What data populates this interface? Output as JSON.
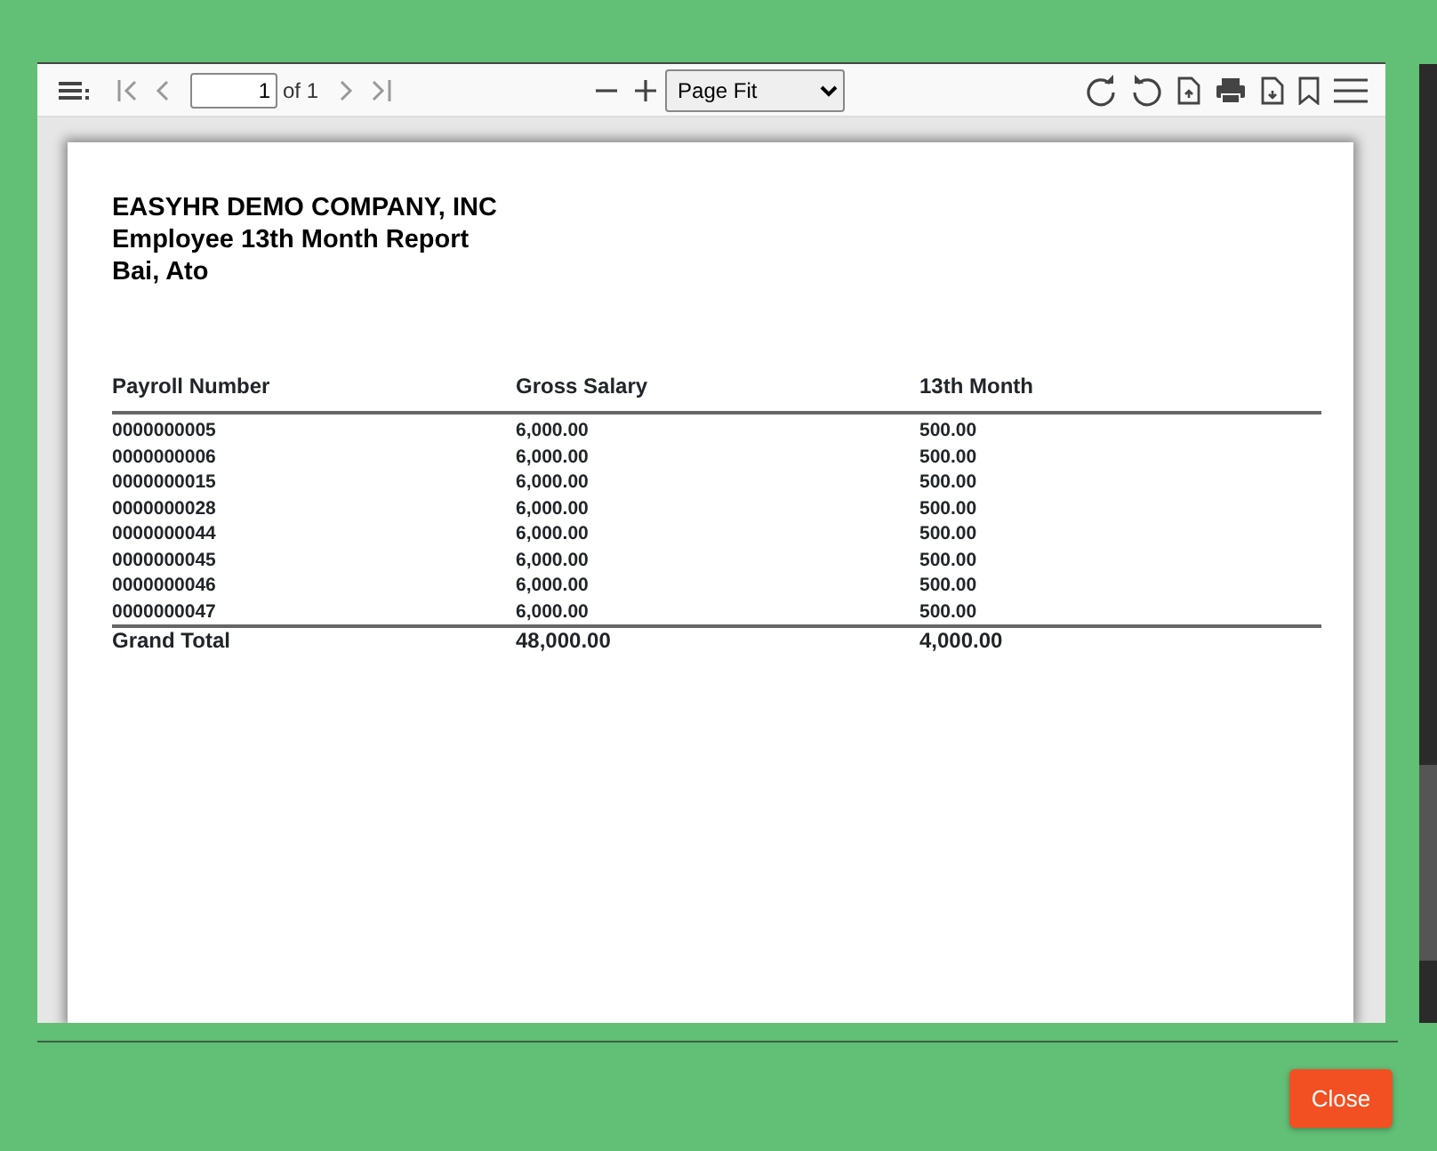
{
  "toolbar": {
    "page_number": "1",
    "page_count": "of 1",
    "zoom": "Page Fit"
  },
  "report": {
    "company": "EASYHR DEMO COMPANY, INC",
    "title": "Employee 13th Month Report",
    "employee": "Bai, Ato",
    "columns": [
      "Payroll Number",
      "Gross Salary",
      "13th Month"
    ],
    "rows": [
      [
        "0000000005",
        "6,000.00",
        "500.00"
      ],
      [
        "0000000006",
        "6,000.00",
        "500.00"
      ],
      [
        "0000000015",
        "6,000.00",
        "500.00"
      ],
      [
        "0000000028",
        "6,000.00",
        "500.00"
      ],
      [
        "0000000044",
        "6,000.00",
        "500.00"
      ],
      [
        "0000000045",
        "6,000.00",
        "500.00"
      ],
      [
        "0000000046",
        "6,000.00",
        "500.00"
      ],
      [
        "0000000047",
        "6,000.00",
        "500.00"
      ]
    ],
    "total": [
      "Grand Total",
      "48,000.00",
      "4,000.00"
    ]
  },
  "footer": {
    "close_button": "Close"
  }
}
